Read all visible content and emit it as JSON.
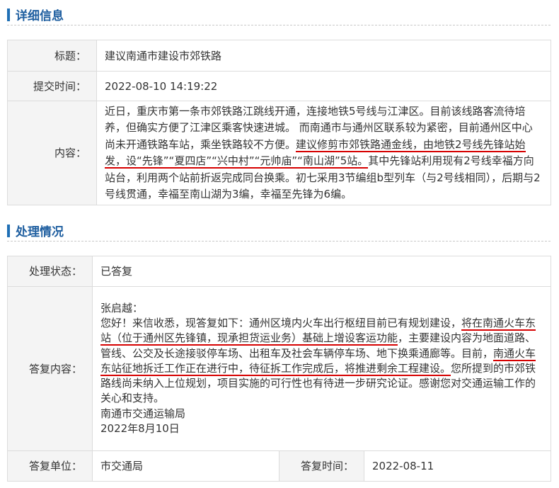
{
  "detail": {
    "section_title": "详细信息",
    "title_label": "标题：",
    "title_value": "建议南通市建设市郊铁路",
    "time_label": "提交时间：",
    "time_value": "2022-08-10 14:19:22",
    "content_label": "内容：",
    "content_parts": [
      "近日，重庆市第一条市郊铁路江跳线开通，连接地铁5号线与江津区。目前该线路客流待培养，但确实方便了江津区乘客快速进城。 而南通市与通州区联系较为紧密，目前通州区中心尚未开通铁路车站，乘坐铁路较不方便。",
      "建议修剪市郊铁路通金线，由地铁2号线先锋站始发，设“先锋”“夏四店”“兴中村”“元帅庙”“南山湖”5站。",
      "其中先锋站利用现有2号线幸福方向站台，利用两个站前折返完成同台换乘。初七采用3节编组b型列车（与2号线相同），后期与2号线贯通，幸福至南山湖为3编，幸福至先锋为6编。"
    ]
  },
  "process": {
    "section_title": "处理情况",
    "status_label": "处理状态：",
    "status_value": "已答复",
    "reply_label": "答复内容：",
    "reply_greeting": "张启越：",
    "reply_parts": [
      "您好！来信收悉，现答复如下：通州区境内火车出行枢纽目前已有规划建设，",
      "将在南通火车东站（位于通州区先锋镇，现承担货运业务）基础上增设客运功能",
      "，主要建设内容为地面道路、管线、公交及长途接驳停车场、出租车及社会车辆停车场、地下换乘通廊等。目前，",
      "南通火车东站征地拆迁工作正在进行中，待征拆工作完成后，将推进剩余工程建设。",
      "您所提到的市郊铁路线尚未纳入上位规划，项目实施的可行性也有待进一步研究论证。感谢您对交通运输工作的关心和支持。"
    ],
    "reply_signoff": "南通市交通运输局",
    "reply_date": "2022年8月10日",
    "unit_label": "答复单位：",
    "unit_value": "市交通局",
    "reply_time_label": "答复时间：",
    "reply_time_value": "2022-08-11"
  },
  "colors": {
    "accent": "#1f5fa0",
    "underline": "#d60000"
  }
}
